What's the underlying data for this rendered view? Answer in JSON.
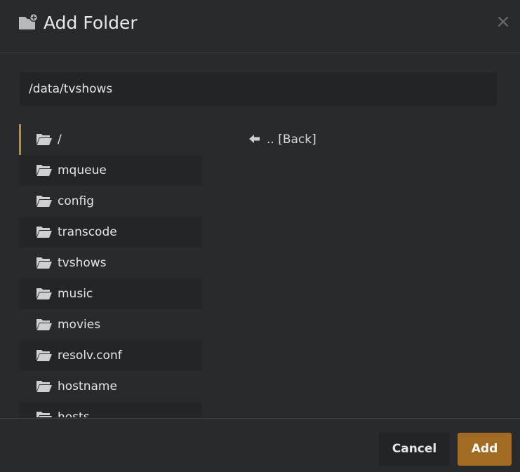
{
  "dialog": {
    "title": "Add Folder",
    "title_icon": "folder-plus-icon",
    "close_icon": "close-icon",
    "close_glyph": "×"
  },
  "path_input": {
    "value": "/data/tvshows"
  },
  "folders": [
    {
      "label": "/",
      "selected": true
    },
    {
      "label": "mqueue"
    },
    {
      "label": "config"
    },
    {
      "label": "transcode"
    },
    {
      "label": "tvshows"
    },
    {
      "label": "music"
    },
    {
      "label": "movies"
    },
    {
      "label": "resolv.conf"
    },
    {
      "label": "hostname"
    },
    {
      "label": "hosts"
    }
  ],
  "back": {
    "label": ".. [Back]",
    "icon": "arrow-left-icon"
  },
  "footer": {
    "cancel_label": "Cancel",
    "add_label": "Add"
  },
  "colors": {
    "accent": "#c08a2e",
    "add_button": "#a16c22",
    "background": "#282a2d"
  }
}
